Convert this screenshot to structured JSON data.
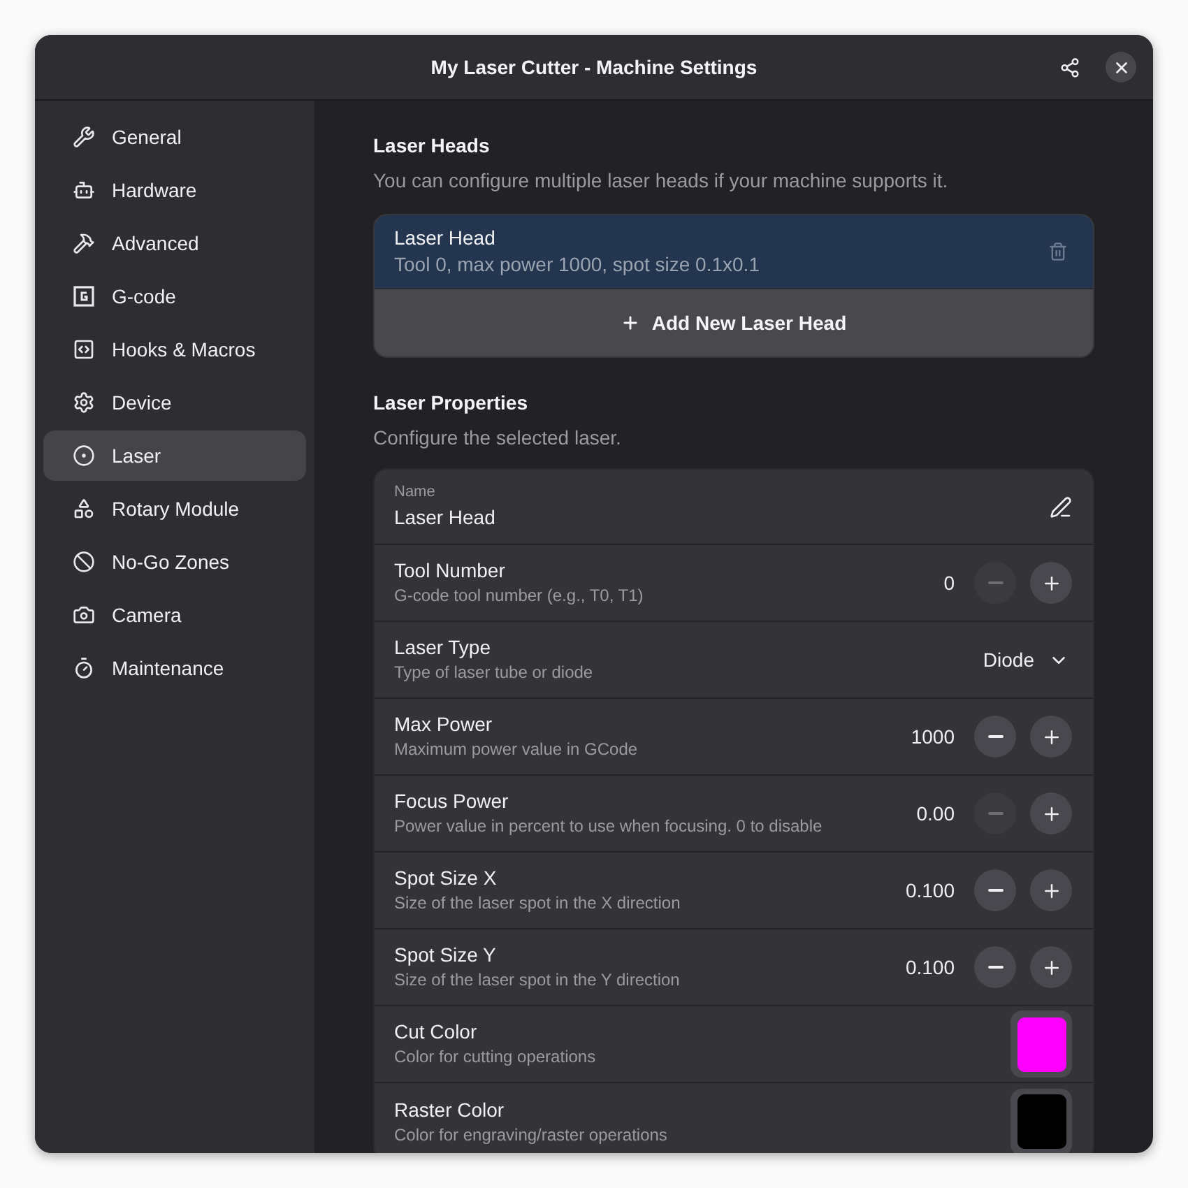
{
  "window": {
    "title": "My Laser Cutter - Machine Settings"
  },
  "sidebar": {
    "items": [
      {
        "label": "General",
        "selected": false
      },
      {
        "label": "Hardware",
        "selected": false
      },
      {
        "label": "Advanced",
        "selected": false
      },
      {
        "label": "G-code",
        "selected": false
      },
      {
        "label": "Hooks & Macros",
        "selected": false
      },
      {
        "label": "Device",
        "selected": false
      },
      {
        "label": "Laser",
        "selected": true
      },
      {
        "label": "Rotary Module",
        "selected": false
      },
      {
        "label": "No-Go Zones",
        "selected": false
      },
      {
        "label": "Camera",
        "selected": false
      },
      {
        "label": "Maintenance",
        "selected": false
      }
    ]
  },
  "laser_heads": {
    "title": "Laser Heads",
    "description": "You can configure multiple laser heads if your machine supports it.",
    "items": [
      {
        "name": "Laser Head",
        "summary": "Tool 0, max power 1000, spot size 0.1x0.1",
        "selected": true
      }
    ],
    "add_button": "Add New Laser Head"
  },
  "laser_properties": {
    "title": "Laser Properties",
    "description": "Configure the selected laser.",
    "rows": [
      {
        "kind": "entry",
        "label": "Name",
        "value": "Laser Head"
      },
      {
        "kind": "spin",
        "label": "Tool Number",
        "subtitle": "G-code tool number (e.g., T0, T1)",
        "value": "0",
        "minus_disabled": true
      },
      {
        "kind": "dropdown",
        "label": "Laser Type",
        "subtitle": "Type of laser tube or diode",
        "value": "Diode"
      },
      {
        "kind": "spin",
        "label": "Max Power",
        "subtitle": "Maximum power value in GCode",
        "value": "1000",
        "minus_disabled": false
      },
      {
        "kind": "spin",
        "label": "Focus Power",
        "subtitle": "Power value in percent to use when focusing. 0 to disable",
        "value": "0.00",
        "minus_disabled": true
      },
      {
        "kind": "spin",
        "label": "Spot Size X",
        "subtitle": "Size of the laser spot in the X direction",
        "value": "0.100",
        "minus_disabled": false
      },
      {
        "kind": "spin",
        "label": "Spot Size Y",
        "subtitle": "Size of the laser spot in the Y direction",
        "value": "0.100",
        "minus_disabled": false
      },
      {
        "kind": "color",
        "label": "Cut Color",
        "subtitle": "Color for cutting operations",
        "color": "#ff00ff"
      },
      {
        "kind": "color",
        "label": "Raster Color",
        "subtitle": "Color for engraving/raster operations",
        "color": "#000000"
      }
    ]
  }
}
